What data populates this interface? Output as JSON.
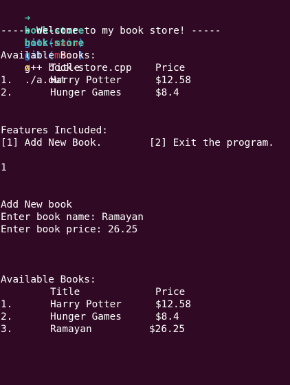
{
  "prompt": {
    "arrow": "➜",
    "dir": "book-store",
    "git_label": "git:(",
    "branch": "main",
    "git_close": ")",
    "dirty_mark": "✗"
  },
  "commands": [
    "g++ book-store.cpp",
    "./a.out"
  ],
  "welcome": "----- Welcome to my book store! -----",
  "available_heading": "Available Books:",
  "table_headers": {
    "title": "Title",
    "price": "Price"
  },
  "books_first": [
    {
      "num": "1.",
      "title": "Harry Potter",
      "price": "$12.58"
    },
    {
      "num": "2.",
      "title": "Hunger Games",
      "price": "$8.4"
    }
  ],
  "features_heading": "Features Included:",
  "features": {
    "option1": "[1] Add New Book.",
    "option2": "[2] Exit the program."
  },
  "user_choice": "1",
  "add_heading": "Add New book",
  "prompt_name": "Enter book name: Ramayan",
  "prompt_price": "Enter book price: 26.25",
  "books_second": [
    {
      "num": "1.",
      "title": "Harry Potter",
      "price": "$12.58"
    },
    {
      "num": "2.",
      "title": "Hunger Games",
      "price": "$8.4"
    },
    {
      "num": "3.",
      "title": "Ramayan",
      "price": "$26.25"
    }
  ],
  "colors": {
    "background": "#300a24",
    "prompt_arrow": "#4ec9b0",
    "prompt_dir": "#4ec9b0",
    "git_label": "#2f7fd7",
    "branch": "#e04545",
    "dirty_mark": "#e8c54a",
    "text": "#ffffff"
  }
}
